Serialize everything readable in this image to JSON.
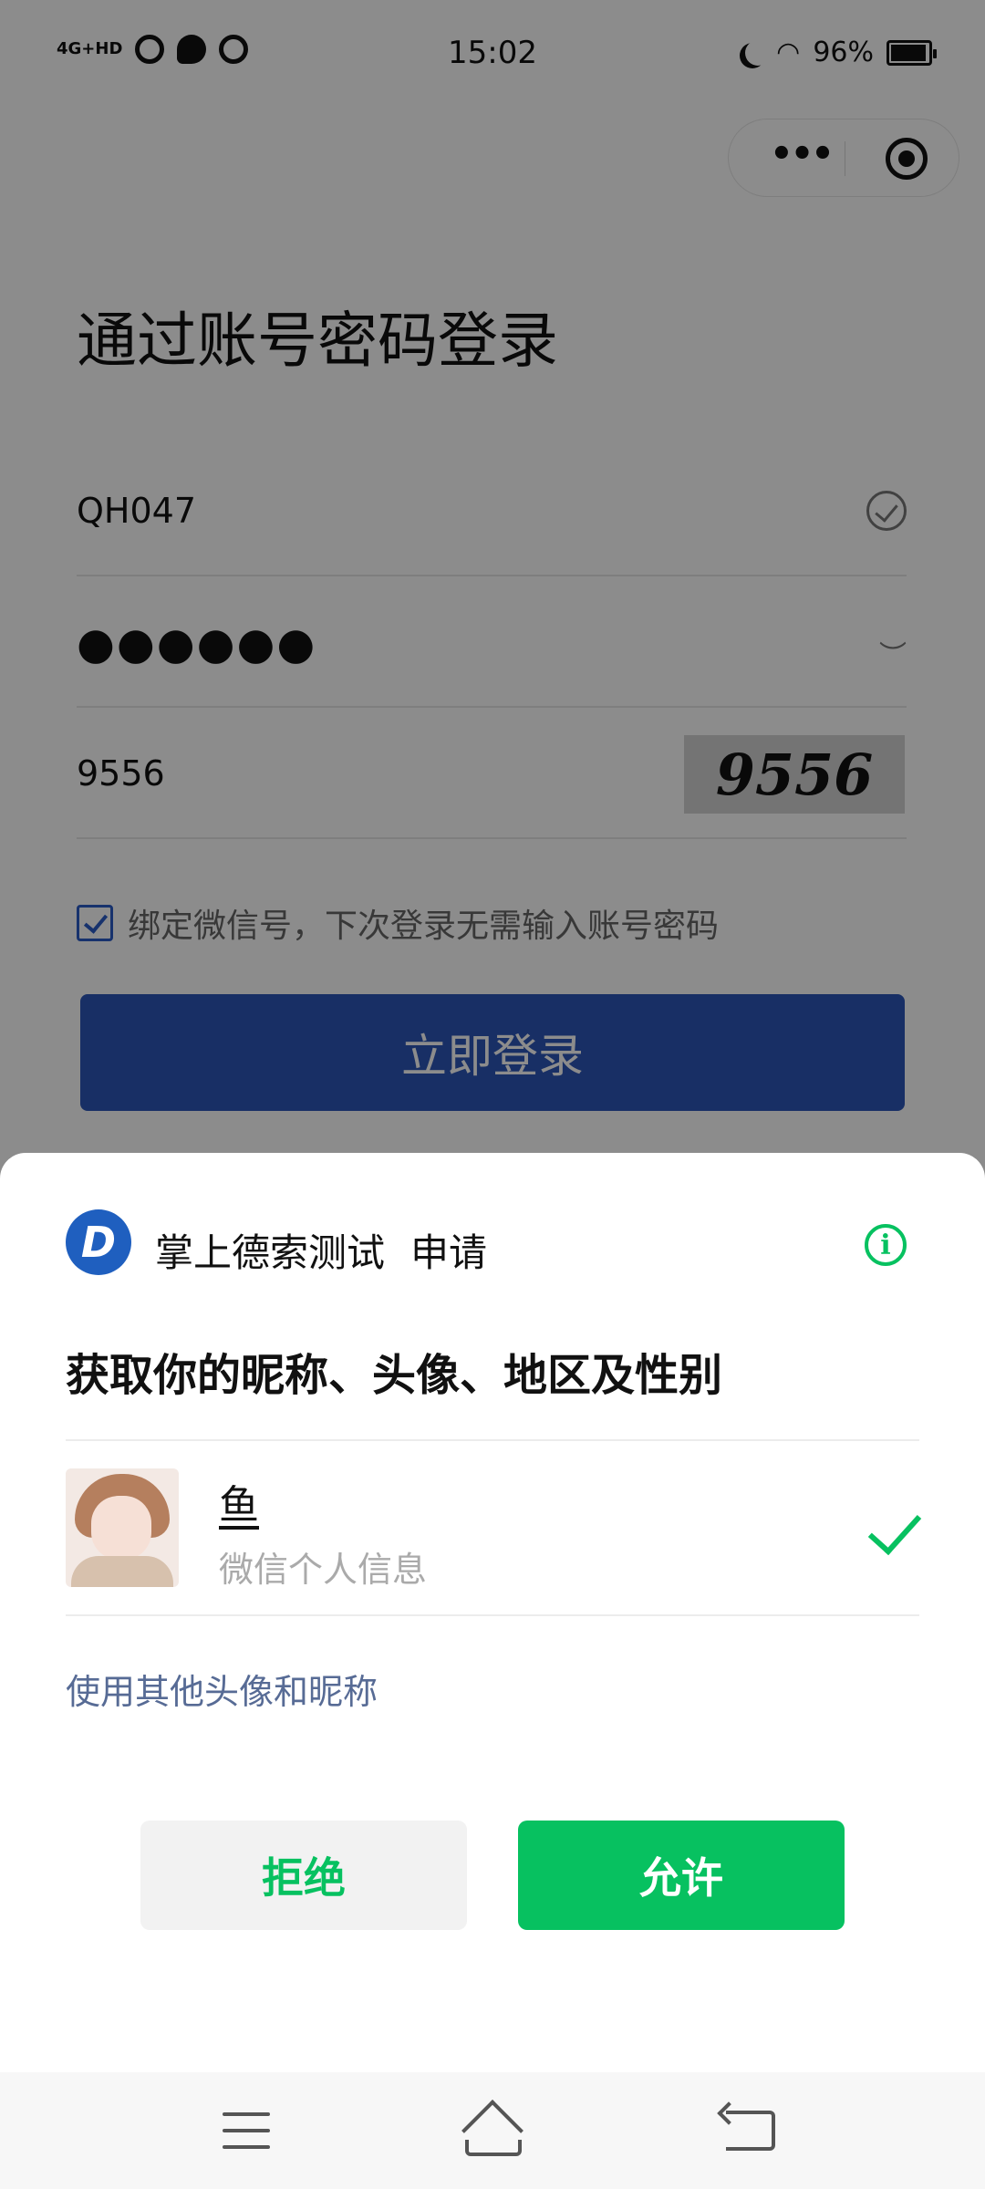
{
  "status_bar": {
    "network": "4G+HD",
    "time": "15:02",
    "battery": "96%"
  },
  "capsule": {
    "more_icon": "more-dots-icon",
    "close_icon": "target-icon"
  },
  "login": {
    "title": "通过账号密码登录",
    "account_value": "QH047",
    "password_mask": "●●●●●●",
    "captcha_value": "9556",
    "captcha_image_text": "9556",
    "bind_label": "绑定微信号，下次登录无需输入账号密码",
    "login_button": "立即登录"
  },
  "sheet": {
    "app_name": "掌上德索测试",
    "apply": "申请",
    "request_title": "获取你的昵称、头像、地区及性别",
    "nickname": "鱼",
    "nickname_sub": "微信个人信息",
    "other_link": "使用其他头像和昵称",
    "deny_button": "拒绝",
    "allow_button": "允许"
  },
  "colors": {
    "primary_blue": "#2d56b8",
    "wechat_green": "#07c160",
    "link_blue": "#576b95"
  }
}
